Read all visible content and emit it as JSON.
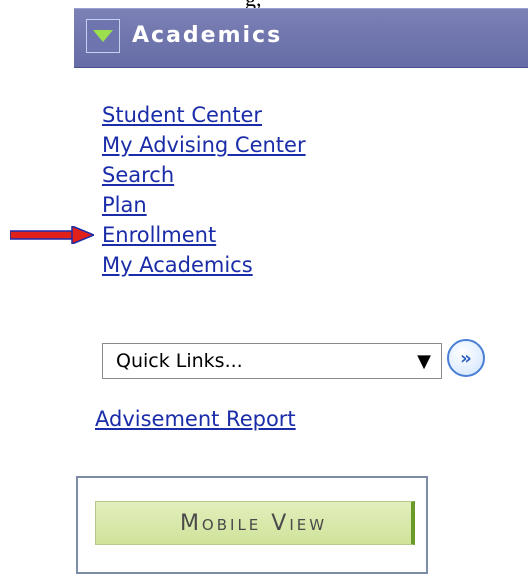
{
  "top_fragment": "g,",
  "header": {
    "title": "Academics",
    "toggle_icon": "triangle-down-icon",
    "background_color": "#6e74ab"
  },
  "links": [
    {
      "label": "Student Center"
    },
    {
      "label": "My Advising Center"
    },
    {
      "label": "Search"
    },
    {
      "label": "Plan"
    },
    {
      "label": "Enrollment",
      "highlighted_by_arrow": true
    },
    {
      "label": "My Academics"
    }
  ],
  "pointer_arrow": {
    "icon": "red-arrow-right-icon",
    "color": "#e0201a"
  },
  "quick_links": {
    "selected": "Quick Links...",
    "caret_icon": "dropdown-triangle-icon",
    "go_button_icon": "double-chevron-right-icon",
    "go_button_label": "»"
  },
  "advisement_report": {
    "label": "Advisement Report"
  },
  "mobile_view": {
    "label": "Mobile View",
    "accent_color": "#6a9a2a"
  }
}
